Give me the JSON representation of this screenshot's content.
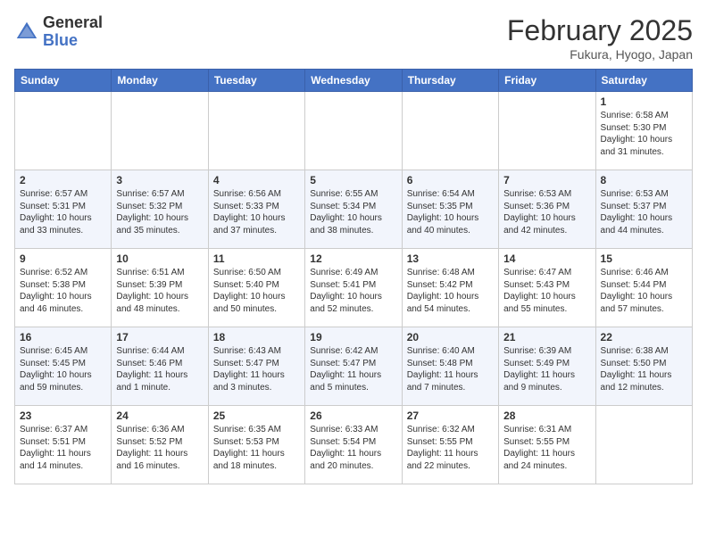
{
  "header": {
    "logo_general": "General",
    "logo_blue": "Blue",
    "month_title": "February 2025",
    "location": "Fukura, Hyogo, Japan"
  },
  "days_of_week": [
    "Sunday",
    "Monday",
    "Tuesday",
    "Wednesday",
    "Thursday",
    "Friday",
    "Saturday"
  ],
  "weeks": [
    [
      {
        "day": "",
        "info": ""
      },
      {
        "day": "",
        "info": ""
      },
      {
        "day": "",
        "info": ""
      },
      {
        "day": "",
        "info": ""
      },
      {
        "day": "",
        "info": ""
      },
      {
        "day": "",
        "info": ""
      },
      {
        "day": "1",
        "info": "Sunrise: 6:58 AM\nSunset: 5:30 PM\nDaylight: 10 hours and 31 minutes."
      }
    ],
    [
      {
        "day": "2",
        "info": "Sunrise: 6:57 AM\nSunset: 5:31 PM\nDaylight: 10 hours and 33 minutes."
      },
      {
        "day": "3",
        "info": "Sunrise: 6:57 AM\nSunset: 5:32 PM\nDaylight: 10 hours and 35 minutes."
      },
      {
        "day": "4",
        "info": "Sunrise: 6:56 AM\nSunset: 5:33 PM\nDaylight: 10 hours and 37 minutes."
      },
      {
        "day": "5",
        "info": "Sunrise: 6:55 AM\nSunset: 5:34 PM\nDaylight: 10 hours and 38 minutes."
      },
      {
        "day": "6",
        "info": "Sunrise: 6:54 AM\nSunset: 5:35 PM\nDaylight: 10 hours and 40 minutes."
      },
      {
        "day": "7",
        "info": "Sunrise: 6:53 AM\nSunset: 5:36 PM\nDaylight: 10 hours and 42 minutes."
      },
      {
        "day": "8",
        "info": "Sunrise: 6:53 AM\nSunset: 5:37 PM\nDaylight: 10 hours and 44 minutes."
      }
    ],
    [
      {
        "day": "9",
        "info": "Sunrise: 6:52 AM\nSunset: 5:38 PM\nDaylight: 10 hours and 46 minutes."
      },
      {
        "day": "10",
        "info": "Sunrise: 6:51 AM\nSunset: 5:39 PM\nDaylight: 10 hours and 48 minutes."
      },
      {
        "day": "11",
        "info": "Sunrise: 6:50 AM\nSunset: 5:40 PM\nDaylight: 10 hours and 50 minutes."
      },
      {
        "day": "12",
        "info": "Sunrise: 6:49 AM\nSunset: 5:41 PM\nDaylight: 10 hours and 52 minutes."
      },
      {
        "day": "13",
        "info": "Sunrise: 6:48 AM\nSunset: 5:42 PM\nDaylight: 10 hours and 54 minutes."
      },
      {
        "day": "14",
        "info": "Sunrise: 6:47 AM\nSunset: 5:43 PM\nDaylight: 10 hours and 55 minutes."
      },
      {
        "day": "15",
        "info": "Sunrise: 6:46 AM\nSunset: 5:44 PM\nDaylight: 10 hours and 57 minutes."
      }
    ],
    [
      {
        "day": "16",
        "info": "Sunrise: 6:45 AM\nSunset: 5:45 PM\nDaylight: 10 hours and 59 minutes."
      },
      {
        "day": "17",
        "info": "Sunrise: 6:44 AM\nSunset: 5:46 PM\nDaylight: 11 hours and 1 minute."
      },
      {
        "day": "18",
        "info": "Sunrise: 6:43 AM\nSunset: 5:47 PM\nDaylight: 11 hours and 3 minutes."
      },
      {
        "day": "19",
        "info": "Sunrise: 6:42 AM\nSunset: 5:47 PM\nDaylight: 11 hours and 5 minutes."
      },
      {
        "day": "20",
        "info": "Sunrise: 6:40 AM\nSunset: 5:48 PM\nDaylight: 11 hours and 7 minutes."
      },
      {
        "day": "21",
        "info": "Sunrise: 6:39 AM\nSunset: 5:49 PM\nDaylight: 11 hours and 9 minutes."
      },
      {
        "day": "22",
        "info": "Sunrise: 6:38 AM\nSunset: 5:50 PM\nDaylight: 11 hours and 12 minutes."
      }
    ],
    [
      {
        "day": "23",
        "info": "Sunrise: 6:37 AM\nSunset: 5:51 PM\nDaylight: 11 hours and 14 minutes."
      },
      {
        "day": "24",
        "info": "Sunrise: 6:36 AM\nSunset: 5:52 PM\nDaylight: 11 hours and 16 minutes."
      },
      {
        "day": "25",
        "info": "Sunrise: 6:35 AM\nSunset: 5:53 PM\nDaylight: 11 hours and 18 minutes."
      },
      {
        "day": "26",
        "info": "Sunrise: 6:33 AM\nSunset: 5:54 PM\nDaylight: 11 hours and 20 minutes."
      },
      {
        "day": "27",
        "info": "Sunrise: 6:32 AM\nSunset: 5:55 PM\nDaylight: 11 hours and 22 minutes."
      },
      {
        "day": "28",
        "info": "Sunrise: 6:31 AM\nSunset: 5:55 PM\nDaylight: 11 hours and 24 minutes."
      },
      {
        "day": "",
        "info": ""
      }
    ]
  ]
}
